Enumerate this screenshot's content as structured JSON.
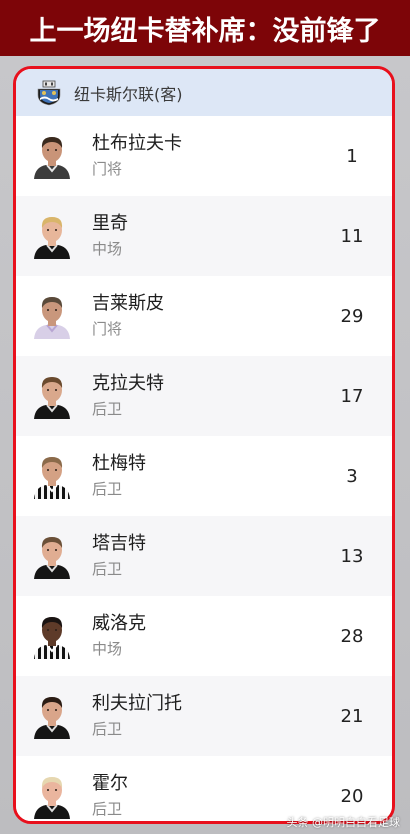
{
  "banner": {
    "title": "上一场纽卡替补席：没前锋了"
  },
  "team": {
    "name": "纽卡斯尔联(客)",
    "crest_icon": "newcastle-crest-icon"
  },
  "players": [
    {
      "name": "杜布拉夫卡",
      "position": "门将",
      "number": "1",
      "kit": "gk",
      "hair": "#3a2a1e",
      "skin": "#c99478"
    },
    {
      "name": "里奇",
      "position": "中场",
      "number": "11",
      "kit": "black",
      "hair": "#d9b56a",
      "skin": "#e7b69a"
    },
    {
      "name": "吉莱斯皮",
      "position": "门将",
      "number": "29",
      "kit": "gk2",
      "hair": "#5a4a3a",
      "skin": "#c9977c"
    },
    {
      "name": "克拉夫特",
      "position": "后卫",
      "number": "17",
      "kit": "black",
      "hair": "#6a4a2e",
      "skin": "#d9a88c"
    },
    {
      "name": "杜梅特",
      "position": "后卫",
      "number": "3",
      "kit": "stripe",
      "hair": "#8b6a4a",
      "skin": "#d4a184"
    },
    {
      "name": "塔吉特",
      "position": "后卫",
      "number": "13",
      "kit": "black",
      "hair": "#6b5038",
      "skin": "#e0ad92"
    },
    {
      "name": "威洛克",
      "position": "中场",
      "number": "28",
      "kit": "stripe",
      "hair": "#1a1412",
      "skin": "#5e3b29"
    },
    {
      "name": "利夫拉门托",
      "position": "后卫",
      "number": "21",
      "kit": "black",
      "hair": "#2b1c14",
      "skin": "#d9a58a"
    },
    {
      "name": "霍尔",
      "position": "后卫",
      "number": "20",
      "kit": "black",
      "hair": "#e6d7b0",
      "skin": "#eab59e"
    }
  ],
  "colors": {
    "banner": "#7d0508",
    "panel_border": "#e8101c",
    "header_bg": "#dde7f6"
  },
  "watermark": "头条 @明明白白看足球"
}
